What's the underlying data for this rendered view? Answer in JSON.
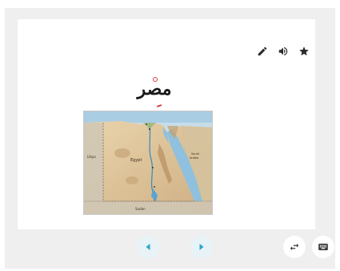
{
  "card": {
    "word": "مصر",
    "map_labels": [
      "Egypt",
      "Libya",
      "Sudan",
      "Saudi Arabia"
    ]
  },
  "toolbar": {
    "icons": [
      "pencil-icon",
      "speaker-icon",
      "star-icon"
    ]
  },
  "nav": {
    "prev_icon": "triangle-left-icon",
    "next_icon": "triangle-right-icon",
    "swap_icon": "swap-arrows-icon",
    "keyboard_icon": "keyboard-icon"
  },
  "colors": {
    "accent": "#29a7c9",
    "diacritic": "#d04040",
    "background": "#efefef"
  }
}
